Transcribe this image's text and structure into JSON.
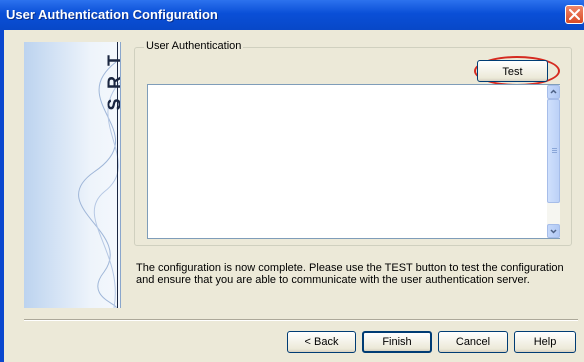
{
  "window": {
    "title": "User Authentication Configuration"
  },
  "banner": {
    "letters": [
      "T",
      "R",
      "S"
    ]
  },
  "group": {
    "label": "User Authentication"
  },
  "buttons": {
    "test": "Test",
    "back": "< Back",
    "finish": "Finish",
    "cancel": "Cancel",
    "help": "Help"
  },
  "results_text": "",
  "message": "The configuration is now complete. Please use the TEST button to test the configuration and ensure that you are able to communicate with the user authentication server.",
  "colors": {
    "titlebar": "#0a4fd7",
    "dialog_bg": "#ece9d8",
    "highlight_ring": "#d52a20"
  }
}
